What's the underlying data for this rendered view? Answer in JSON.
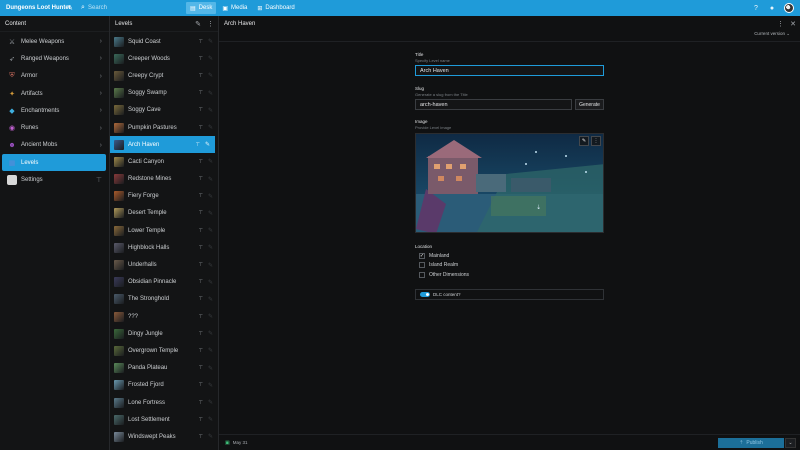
{
  "app": {
    "title": "Dungeons Loot Hunter"
  },
  "topbar": {
    "search_placeholder": "Search",
    "tabs": [
      {
        "label": "Desk",
        "icon": "desk-icon",
        "active": true
      },
      {
        "label": "Media",
        "icon": "media-icon",
        "active": false
      },
      {
        "label": "Dashboard",
        "icon": "dashboard-icon",
        "active": false
      }
    ]
  },
  "content_pane": {
    "title": "Content",
    "items": [
      {
        "label": "Melee Weapons",
        "icon": "sword-icon",
        "color": "#9aa0a6",
        "has_chevron": true,
        "active": false
      },
      {
        "label": "Ranged Weapons",
        "icon": "bow-icon",
        "color": "#9aa0a6",
        "has_chevron": true,
        "active": false
      },
      {
        "label": "Armor",
        "icon": "armor-icon",
        "color": "#c86a5c",
        "has_chevron": true,
        "active": false
      },
      {
        "label": "Artifacts",
        "icon": "artifact-icon",
        "color": "#d39a3a",
        "has_chevron": true,
        "active": false
      },
      {
        "label": "Enchantments",
        "icon": "enchantment-icon",
        "color": "#3fb0e0",
        "has_chevron": true,
        "active": false
      },
      {
        "label": "Runes",
        "icon": "rune-icon",
        "color": "#c060d0",
        "has_chevron": true,
        "active": false
      },
      {
        "label": "Ancient Mobs",
        "icon": "mob-icon",
        "color": "#9a50c0",
        "has_chevron": true,
        "active": false
      },
      {
        "label": "Levels",
        "icon": "levels-icon",
        "color": "#5a8ad8",
        "has_chevron": false,
        "active": true
      },
      {
        "label": "Settings",
        "icon": "settings-icon",
        "color": "#c8c8c8",
        "has_chevron": true,
        "active": false
      }
    ]
  },
  "levels_pane": {
    "title": "Levels",
    "items": [
      {
        "label": "Squid Coast",
        "thumb": "#4a7a8a"
      },
      {
        "label": "Creeper Woods",
        "thumb": "#3a6a5a"
      },
      {
        "label": "Creepy Crypt",
        "thumb": "#6a5a3a"
      },
      {
        "label": "Soggy Swamp",
        "thumb": "#5a7a4a"
      },
      {
        "label": "Soggy Cave",
        "thumb": "#7a6a3a"
      },
      {
        "label": "Pumpkin Pastures",
        "thumb": "#b06a3a"
      },
      {
        "label": "Arch Haven",
        "thumb": "#3a5a8a",
        "active": true
      },
      {
        "label": "Cacti Canyon",
        "thumb": "#a08a4a"
      },
      {
        "label": "Redstone Mines",
        "thumb": "#8a3a3a"
      },
      {
        "label": "Fiery Forge",
        "thumb": "#aa5a2a"
      },
      {
        "label": "Desert Temple",
        "thumb": "#b09a5a"
      },
      {
        "label": "Lower Temple",
        "thumb": "#8a6a3a"
      },
      {
        "label": "Highblock Halls",
        "thumb": "#5a5a6a"
      },
      {
        "label": "Underhalls",
        "thumb": "#6a5a4a"
      },
      {
        "label": "Obsidian Pinnacle",
        "thumb": "#3a3a5a"
      },
      {
        "label": "The Stronghold",
        "thumb": "#4a5a6a"
      },
      {
        "label": "???",
        "thumb": "#8a5a3a"
      },
      {
        "label": "Dingy Jungle",
        "thumb": "#3a6a3a"
      },
      {
        "label": "Overgrown Temple",
        "thumb": "#5a6a3a"
      },
      {
        "label": "Panda Plateau",
        "thumb": "#5a8a5a"
      },
      {
        "label": "Frosted Fjord",
        "thumb": "#6a9ab0"
      },
      {
        "label": "Lone Fortress",
        "thumb": "#5a7a8a"
      },
      {
        "label": "Lost Settlement",
        "thumb": "#4a6a6a"
      },
      {
        "label": "Windswept Peaks",
        "thumb": "#7a8a9a"
      }
    ]
  },
  "document": {
    "title": "Arch Haven",
    "version_label": "Current version",
    "fields": {
      "title": {
        "label": "Title",
        "description": "Specify Level name",
        "value": "Arch Haven"
      },
      "slug": {
        "label": "Slug",
        "description": "Generate a slug from the Title",
        "value": "arch-haven",
        "button": "Generate"
      },
      "image": {
        "label": "Image",
        "description": "Provide Level image"
      },
      "location": {
        "label": "Location",
        "options": [
          {
            "label": "Mainland",
            "checked": true
          },
          {
            "label": "Island Realm",
            "checked": false
          },
          {
            "label": "Other Dimensions",
            "checked": false
          }
        ]
      },
      "dlc": {
        "label": "DLC content?",
        "on": true
      }
    },
    "footer": {
      "status": "May 31",
      "publish_label": "Publish"
    }
  },
  "colors": {
    "accent": "#1f9bd9",
    "background": "#101112"
  }
}
